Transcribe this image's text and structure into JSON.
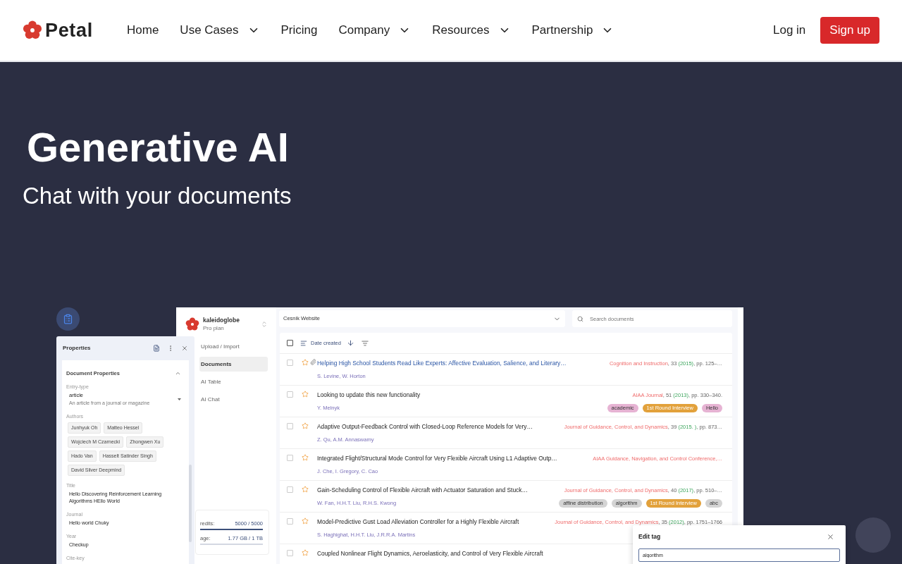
{
  "header": {
    "logo": "Petal",
    "nav": [
      {
        "label": "Home",
        "dropdown": false
      },
      {
        "label": "Use Cases",
        "dropdown": true
      },
      {
        "label": "Pricing",
        "dropdown": false
      },
      {
        "label": "Company",
        "dropdown": true
      },
      {
        "label": "Resources",
        "dropdown": true
      },
      {
        "label": "Partnership",
        "dropdown": true
      }
    ],
    "login": "Log in",
    "signup": "Sign up"
  },
  "hero": {
    "title": "Generative AI",
    "subtitle": "Chat with your documents"
  },
  "app": {
    "workspace": {
      "name": "kaleidoglobe",
      "plan": "Pro plan"
    },
    "sidebar_items": [
      {
        "label": "Upload / Import",
        "selected": false
      },
      {
        "label": "Documents",
        "selected": true
      },
      {
        "label": "AI Table",
        "selected": false
      },
      {
        "label": "AI Chat",
        "selected": false
      }
    ],
    "usage": [
      {
        "label": "redits:",
        "value": "5000 / 5000",
        "level": 1
      },
      {
        "label": "age:",
        "value": "1.77 GB / 1 TB",
        "level": 0
      }
    ],
    "all_checked": false,
    "collection": "Cesnik Website",
    "search_placeholder": "Search documents",
    "sort_label": "Date created",
    "rows": [
      {
        "title": "Helping High School Students Read Like Experts: Affective Evaluation, Salience, and Literary…",
        "link": true,
        "attachment": true,
        "checked": false,
        "starred": false,
        "authors": "S. Levine, W. Horton",
        "citation": [
          {
            "kind": "venue",
            "text": "Cognition and Instruction"
          },
          {
            "kind": "plain",
            "text": ", 33 "
          },
          {
            "kind": "year",
            "text": "(2015)"
          },
          {
            "kind": "plain",
            "text": ", pp. 125–…"
          }
        ],
        "tags": []
      },
      {
        "title": "Looking to update this new functionality",
        "link": false,
        "attachment": false,
        "checked": false,
        "starred": false,
        "authors": "Y. Melnyk",
        "citation": [
          {
            "kind": "venue",
            "text": "AIAA Journal"
          },
          {
            "kind": "plain",
            "text": ", 51 "
          },
          {
            "kind": "year",
            "text": "(2013)"
          },
          {
            "kind": "plain",
            "text": ", pp. 330–340."
          }
        ],
        "tags": [
          {
            "label": "academic",
            "color": "#e6b3d3"
          },
          {
            "label": "1st Round Interview",
            "color": "#e2a13b"
          },
          {
            "label": "Hello",
            "color": "#e6b3d3"
          }
        ]
      },
      {
        "title": "Adaptive Output-Feedback Control with Closed-Loop Reference Models for Very…",
        "link": false,
        "attachment": false,
        "checked": false,
        "starred": false,
        "authors": "Z. Qu, A.M. Annaswamy",
        "citation": [
          {
            "kind": "venue",
            "text": "Journal of Guidance, Control, and Dynamics"
          },
          {
            "kind": "plain",
            "text": ", 39 "
          },
          {
            "kind": "year",
            "text": "(2015. )"
          },
          {
            "kind": "plain",
            "text": ", pp. 873…"
          }
        ],
        "tags": []
      },
      {
        "title": "Integrated Flight/Structural Mode Control for Very Flexible Aircraft Using L1 Adaptive Outp…",
        "link": false,
        "attachment": false,
        "checked": false,
        "starred": false,
        "authors": "J. Che, I. Gregory, C. Cao",
        "citation": [
          {
            "kind": "venue",
            "text": "AIAA Guidance, Navigation, and Control Conference,…"
          }
        ],
        "tags": []
      },
      {
        "title": "Gain-Scheduling Control of Flexible Aircraft with Actuator Saturation and Stuck…",
        "link": false,
        "attachment": false,
        "checked": false,
        "starred": false,
        "authors": "W. Fan, H.H.T. Liu, R.H.S. Kwong",
        "citation": [
          {
            "kind": "venue",
            "text": "Journal of Guidance, Control, and Dynamics"
          },
          {
            "kind": "plain",
            "text": ", 40 "
          },
          {
            "kind": "year",
            "text": "(2017)"
          },
          {
            "kind": "plain",
            "text": ", pp. 510–…"
          }
        ],
        "tags": [
          {
            "label": "affine distribution",
            "color": "#d4d4d4"
          },
          {
            "label": "algorithm",
            "color": "#d4d4d4"
          },
          {
            "label": "1st Round Interview",
            "color": "#e2a13b"
          },
          {
            "label": "abc",
            "color": "#d4d4d4"
          }
        ]
      },
      {
        "title": "Model-Predictive Gust Load Alleviation Controller for a Highly Flexible Aircraft",
        "link": false,
        "attachment": false,
        "checked": false,
        "starred": false,
        "authors": "S. Haghighat, H.H.T. Liu, J.R.R.A. Martins",
        "citation": [
          {
            "kind": "venue",
            "text": "Journal of Guidance, Control, and Dynamics"
          },
          {
            "kind": "plain",
            "text": ", 35 "
          },
          {
            "kind": "year",
            "text": "(2012)"
          },
          {
            "kind": "plain",
            "text": ", pp. 1751–1766"
          }
        ],
        "tags": []
      },
      {
        "title": "Coupled Nonlinear Flight Dynamics, Aeroelasticity, and Control of Very Flexible Aircraft",
        "link": false,
        "attachment": false,
        "checked": false,
        "starred": false,
        "citation": [],
        "tags": []
      }
    ],
    "properties": {
      "title": "Properties",
      "section": "Document Properties",
      "expanded": true,
      "fields": [
        {
          "kind": "select",
          "label": "Entry-type",
          "value": "article",
          "hint": "An article from a journal or magazine"
        },
        {
          "kind": "chips",
          "label": "Authors",
          "values": [
            "Junhyuk Oh",
            "Matteo Hessel",
            "Wojciech M Czarnecki",
            "Zhongwen Xu",
            "Hado Van",
            "Hasselt Satinder Singh",
            "David Silver Deepmind"
          ]
        },
        {
          "kind": "text",
          "label": "Title",
          "value": "Hello Discovering Reinforcement Learning Algorithms HEllo World"
        },
        {
          "kind": "text",
          "label": "Journal",
          "value": "Hello world Chuky"
        },
        {
          "kind": "text",
          "label": "Year",
          "value": "Checkup"
        },
        {
          "kind": "label",
          "label": "Cite-key"
        }
      ]
    },
    "edit_tag": {
      "title": "Edit tag",
      "value": "algorithm"
    }
  }
}
